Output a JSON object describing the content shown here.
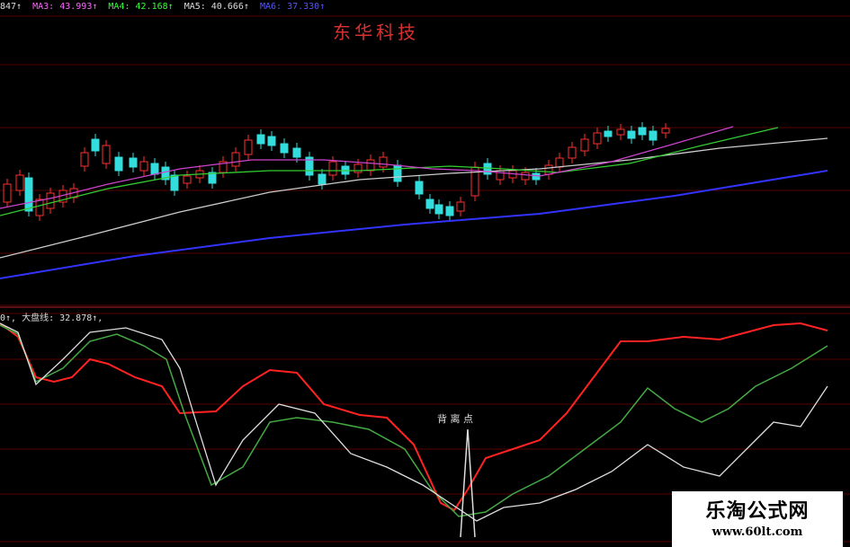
{
  "main_legend": [
    {
      "text": "847↑",
      "color": "#dddddd"
    },
    {
      "text": "MA3: 43.993↑",
      "color": "#ff66ff"
    },
    {
      "text": "MA4: 42.168↑",
      "color": "#33ff33"
    },
    {
      "text": "MA5: 40.666↑",
      "color": "#dddddd"
    },
    {
      "text": "MA6: 37.330↑",
      "color": "#3333ff"
    }
  ],
  "stock_name": "东华科技",
  "indicator_legend": "0↑, 大盘线: 32.878↑,",
  "annotation": "背 离 点",
  "watermark": {
    "title": "乐淘公式网",
    "url": "www.60lt.com"
  },
  "colors": {
    "up": "#ff3030",
    "down": "#33dddd",
    "grid": "#5a0000"
  }
}
